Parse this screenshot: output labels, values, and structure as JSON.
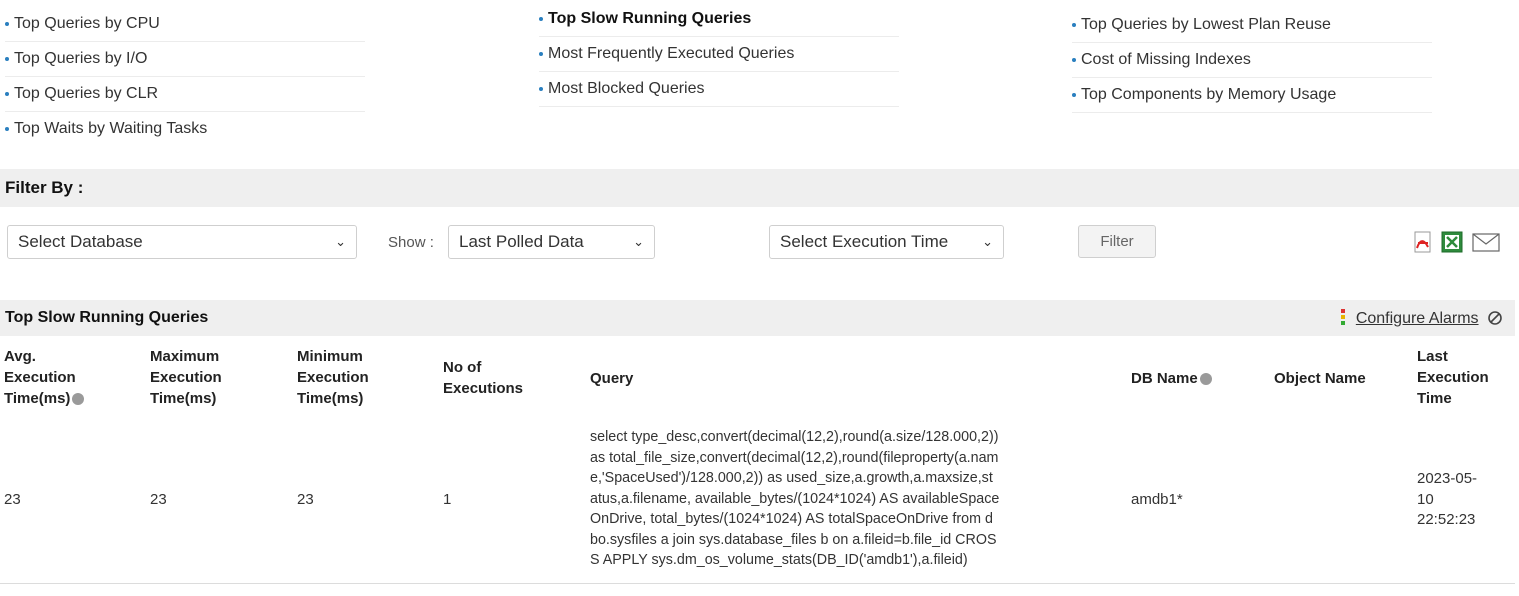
{
  "nav": {
    "col1": [
      "Top Queries by CPU",
      "Top Queries by I/O",
      "Top Queries by CLR",
      "Top Waits by Waiting Tasks"
    ],
    "col2": [
      "Top Slow Running Queries",
      "Most Frequently Executed Queries",
      "Most Blocked Queries"
    ],
    "col3": [
      "Top Queries by Lowest Plan Reuse",
      "Cost of Missing Indexes",
      "Top Components by Memory Usage"
    ],
    "active": "Top Slow Running Queries"
  },
  "filter": {
    "label": "Filter By :",
    "database": "Select Database",
    "show_label": "Show :",
    "show_value": "Last Polled Data",
    "exec_time": "Select Execution Time",
    "button": "Filter",
    "export_icons": [
      "pdf-icon",
      "excel-icon",
      "mail-icon"
    ]
  },
  "table": {
    "title": "Top Slow Running Queries",
    "configure_alarms": "Configure Alarms",
    "headers": {
      "avg": [
        "Avg.",
        "Execution",
        "Time(ms)"
      ],
      "max": [
        "Maximum",
        "Execution",
        "Time(ms)"
      ],
      "min": [
        "Minimum",
        "Execution",
        "Time(ms)"
      ],
      "execs": [
        "No of",
        "Executions"
      ],
      "query": "Query",
      "db": "DB Name",
      "object": "Object Name",
      "last": [
        "Last",
        "Execution",
        "Time"
      ]
    },
    "rows": [
      {
        "avg": "23",
        "max": "23",
        "min": "23",
        "execs": "1",
        "query_lines": [
          "select type_desc,convert(decimal(12,2),round(a.size/128.000,2))",
          "as total_file_size,convert(decimal(12,2),round(fileproperty(a.nam",
          "e,'SpaceUsed')/128.000,2)) as used_size,a.growth,a.maxsize,st",
          "atus,a.filename, available_bytes/(1024*1024) AS availableSpace",
          "OnDrive, total_bytes/(1024*1024) AS totalSpaceOnDrive from d",
          "bo.sysfiles a join sys.database_files b on a.fileid=b.file_id CROS",
          "S APPLY sys.dm_os_volume_stats(DB_ID('amdb1'),a.fileid)"
        ],
        "db": "amdb1*",
        "object": "",
        "last": [
          "2023-05-",
          "10",
          "22:52:23"
        ]
      }
    ]
  }
}
